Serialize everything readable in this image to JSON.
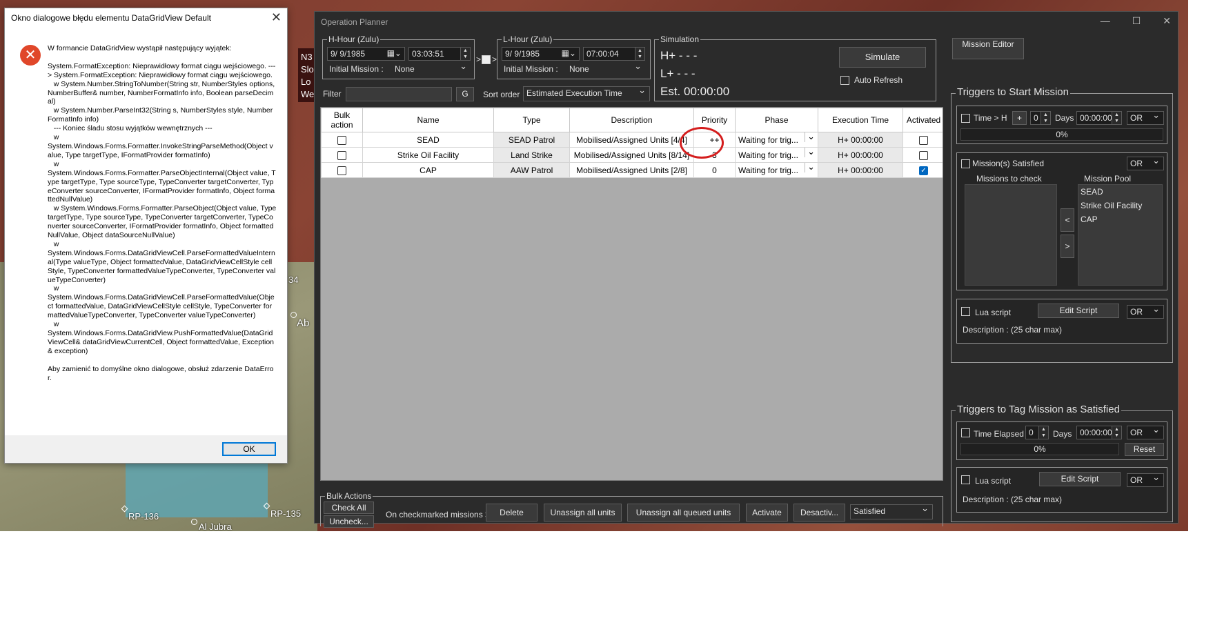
{
  "map": {
    "labels": [
      "N3",
      "Slo",
      "Lo",
      "We",
      "34",
      "Ab",
      "RP-136",
      "RP-135",
      "Al Jubra"
    ]
  },
  "error_dialog": {
    "title": "Okno dialogowe błędu elementu DataGridView Default",
    "message": "W formancie DataGridView wystąpił następujący wyjątek:\n\nSystem.FormatException: Nieprawidłowy format ciągu wejściowego. ---> System.FormatException: Nieprawidłowy format ciągu wejściowego.\n   w System.Number.StringToNumber(String str, NumberStyles options, NumberBuffer& number, NumberFormatInfo info, Boolean parseDecimal)\n   w System.Number.ParseInt32(String s, NumberStyles style, NumberFormatInfo info)\n   --- Koniec śladu stosu wyjątków wewnętrznych ---\n   w\nSystem.Windows.Forms.Formatter.InvokeStringParseMethod(Object value, Type targetType, IFormatProvider formatInfo)\n   w\nSystem.Windows.Forms.Formatter.ParseObjectInternal(Object value, Type targetType, Type sourceType, TypeConverter targetConverter, TypeConverter sourceConverter, IFormatProvider formatInfo, Object formattedNullValue)\n   w System.Windows.Forms.Formatter.ParseObject(Object value, Type targetType, Type sourceType, TypeConverter targetConverter, TypeConverter sourceConverter, IFormatProvider formatInfo, Object formattedNullValue, Object dataSourceNullValue)\n   w\nSystem.Windows.Forms.DataGridViewCell.ParseFormattedValueInternal(Type valueType, Object formattedValue, DataGridViewCellStyle cellStyle, TypeConverter formattedValueTypeConverter, TypeConverter valueTypeConverter)\n   w\nSystem.Windows.Forms.DataGridViewCell.ParseFormattedValue(Object formattedValue, DataGridViewCellStyle cellStyle, TypeConverter formattedValueTypeConverter, TypeConverter valueTypeConverter)\n   w\nSystem.Windows.Forms.DataGridView.PushFormattedValue(DataGridViewCell& dataGridViewCurrentCell, Object formattedValue, Exception& exception)\n\nAby zamienić to domyślne okno dialogowe, obsłuż zdarzenie DataError.",
    "ok_label": "OK",
    "close_glyph": "✕",
    "error_glyph": "✕"
  },
  "planner": {
    "title": "Operation Planner",
    "window_buttons": [
      "—",
      "☐",
      "✕"
    ],
    "h_hour": {
      "legend": "H-Hour (Zulu)",
      "date": "9/  9/1985",
      "time": "03:03:51",
      "initial_mission_label": "Initial Mission :",
      "initial_mission_value": "None"
    },
    "l_hour": {
      "legend": "L-Hour (Zulu)",
      "date": "9/  9/1985",
      "time": "07:00:04",
      "initial_mission_label": "Initial Mission :",
      "initial_mission_value": "None"
    },
    "arrow_left": ">",
    "arrow_right": ">",
    "simulation": {
      "legend": "Simulation",
      "h_plus": "H+ - - -",
      "l_plus": "L+ - - -",
      "est": "Est. 00:00:00",
      "simulate_label": "Simulate",
      "auto_refresh_label": "Auto Refresh"
    },
    "mission_editor_label": "Mission Editor",
    "filter_label": "Filter",
    "filter_value": "",
    "filter_button": "G",
    "sort_label": "Sort order",
    "sort_value": "Estimated Execution Time",
    "grid": {
      "columns": [
        "Bulk action",
        "Name",
        "Type",
        "Description",
        "Priority",
        "Phase",
        "Execution Time",
        "Activated"
      ],
      "rows": [
        {
          "name": "SEAD",
          "type": "SEAD Patrol",
          "description": "Mobilised/Assigned Units [4/4]",
          "priority": "++",
          "phase": "Waiting for trig...",
          "exec": "H+ 00:00:00",
          "activated": false
        },
        {
          "name": "Strike Oil Facility",
          "type": "Land Strike",
          "description": "Mobilised/Assigned Units [8/14]",
          "priority": "3",
          "phase": "Waiting for trig...",
          "exec": "H+ 00:00:00",
          "activated": false
        },
        {
          "name": "CAP",
          "type": "AAW Patrol",
          "description": "Mobilised/Assigned Units [2/8]",
          "priority": "0",
          "phase": "Waiting for trig...",
          "exec": "H+ 00:00:00",
          "activated": true
        }
      ],
      "check_glyph": "✓"
    },
    "bulk": {
      "legend": "Bulk Actions",
      "check_all": "Check All",
      "uncheck": "Uncheck...",
      "on_checkmarked": "On checkmarked missions >",
      "delete": "Delete",
      "unassign_all": "Unassign all units",
      "unassign_queued": "Unassign all queued units",
      "activate": "Activate",
      "deactivate": "Desactiv...",
      "satisfied": "Satisfied"
    },
    "start_triggers": {
      "legend": "Triggers to Start Mission",
      "time_h_label": "Time > H",
      "plus": "+",
      "days_value": "0",
      "days_label": "Days",
      "time_value": "00:00:00",
      "op": "OR",
      "progress": "0%",
      "missions_satisfied_label": "Mission(s) Satisfied",
      "missions_op": "OR",
      "missions_to_check": "Missions to check",
      "mission_pool": "Mission Pool",
      "pool_items": [
        "SEAD",
        "Strike Oil Facility",
        "CAP"
      ],
      "left_arrow": "<",
      "right_arrow": ">",
      "lua_label": "Lua script",
      "edit_script": "Edit Script",
      "lua_op": "OR",
      "description": "Description :  (25 char max)"
    },
    "satisfied_triggers": {
      "legend": "Triggers to Tag Mission as Satisfied",
      "time_elapsed_label": "Time Elapsed",
      "days_value": "0",
      "days_label": "Days",
      "time_value": "00:00:00",
      "op": "OR",
      "progress": "0%",
      "reset": "Reset",
      "lua_label": "Lua script",
      "edit_script": "Edit Script",
      "lua_op": "OR",
      "description": "Description :  (25 char max)"
    }
  }
}
